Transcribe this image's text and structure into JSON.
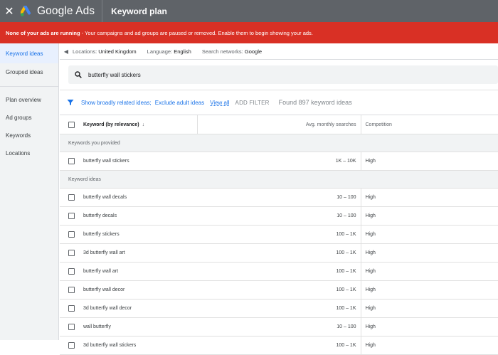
{
  "header": {
    "close_icon": "close-icon",
    "brand": "Google Ads",
    "title": "Keyword plan"
  },
  "alert": {
    "bold_text": "None of your ads are running",
    "text": " - Your campaigns and ad groups are paused or removed. Enable them to begin showing your ads."
  },
  "sidebar": {
    "items": [
      {
        "label": "Keyword ideas"
      },
      {
        "label": "Grouped ideas"
      },
      {
        "label": "Plan overview"
      },
      {
        "label": "Ad groups"
      },
      {
        "label": "Keywords"
      },
      {
        "label": "Locations"
      }
    ]
  },
  "locbar": {
    "locations_label": "Locations:",
    "locations_value": "United Kingdom",
    "language_label": "Language:",
    "language_value": "English",
    "networks_label": "Search networks:",
    "networks_value": "Google"
  },
  "search": {
    "value": "butterfly wall stickers"
  },
  "filter": {
    "show_broad": "Show broadly related ideas;",
    "exclude_adult": "Exclude adult ideas",
    "view_all": "View all",
    "add_filter": "ADD FILTER",
    "found": "Found 897 keyword ideas"
  },
  "table": {
    "headers": {
      "keyword": "Keyword (by relevance)",
      "avg": "Avg. monthly searches",
      "competition": "Competition"
    },
    "group_provided": "Keywords you provided",
    "provided_rows": [
      {
        "keyword": "butterfly wall stickers",
        "avg": "1K – 10K",
        "competition": "High"
      }
    ],
    "group_ideas": "Keyword ideas",
    "idea_rows": [
      {
        "keyword": "butterfly wall decals",
        "avg": "10 – 100",
        "competition": "High"
      },
      {
        "keyword": "butterfly decals",
        "avg": "10 – 100",
        "competition": "High"
      },
      {
        "keyword": "butterfly stickers",
        "avg": "100 – 1K",
        "competition": "High"
      },
      {
        "keyword": "3d butterfly wall art",
        "avg": "100 – 1K",
        "competition": "High"
      },
      {
        "keyword": "butterfly wall art",
        "avg": "100 – 1K",
        "competition": "High"
      },
      {
        "keyword": "butterfly wall decor",
        "avg": "100 – 1K",
        "competition": "High"
      },
      {
        "keyword": "3d butterfly wall decor",
        "avg": "100 – 1K",
        "competition": "High"
      },
      {
        "keyword": "wall butterfly",
        "avg": "10 – 100",
        "competition": "High"
      },
      {
        "keyword": "3d butterfly wall stickers",
        "avg": "100 – 1K",
        "competition": "High"
      }
    ]
  },
  "colors": {
    "topbar": "#5f6368",
    "alert": "#d93025",
    "accent": "#1a73e8"
  }
}
